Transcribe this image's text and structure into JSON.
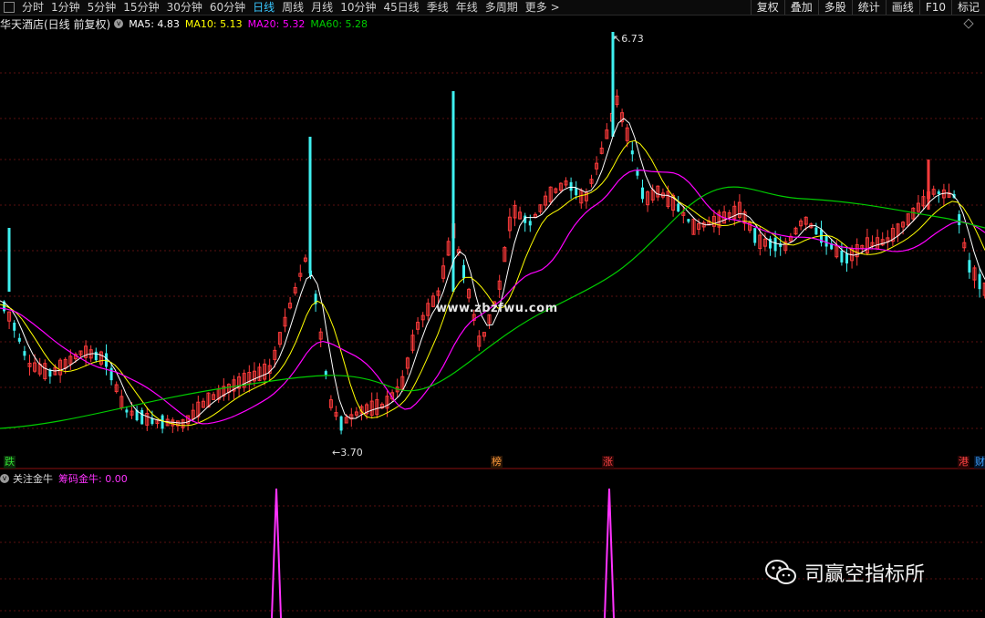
{
  "toolbar": {
    "periods": [
      "分时",
      "1分钟",
      "5分钟",
      "15分钟",
      "30分钟",
      "60分钟",
      "日线",
      "周线",
      "月线",
      "10分钟",
      "45日线",
      "季线",
      "年线",
      "多周期",
      "更多"
    ],
    "active_period": "日线",
    "more_chevron": ">",
    "right_buttons": [
      "复权",
      "叠加",
      "多股",
      "统计",
      "画线",
      "F10",
      "标记"
    ]
  },
  "stock": {
    "title": "华天酒店(日线 前复权)",
    "ma5": "MA5: 4.83",
    "ma10": "MA10: 5.13",
    "ma20": "MA20: 5.32",
    "ma60": "MA60: 5.28"
  },
  "price_labels": {
    "high": "6.73",
    "low": "3.70"
  },
  "watermark": "www.zbzfwu.com",
  "event_tags": [
    "跌",
    "榜",
    "涨",
    "港",
    "财"
  ],
  "indicator": {
    "name": "关注金牛",
    "value": "筹码金牛: 0.00"
  },
  "wechat_account": "司赢空指标所",
  "colors": {
    "up": "#ff3b3b",
    "down": "#3ff0f0",
    "ma5": "#ffffff",
    "ma10": "#ffff00",
    "ma20": "#ff00ff",
    "ma60": "#00cc00",
    "grid": "#5a1010",
    "active_tab": "#39c7ff"
  }
}
